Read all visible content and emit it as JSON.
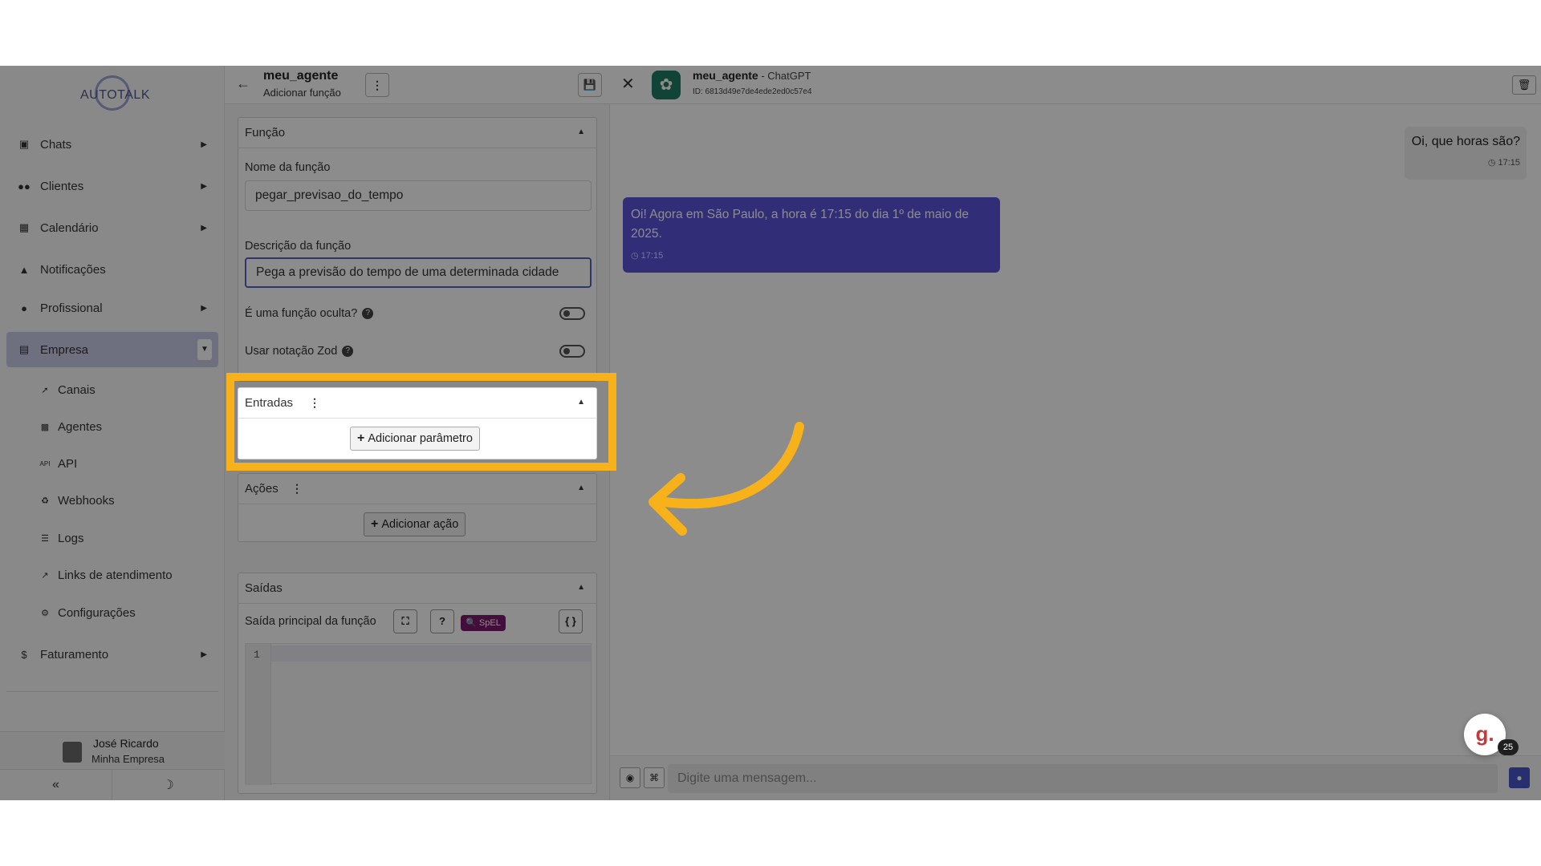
{
  "sidebar": {
    "logo": "AUTOTALK",
    "items": [
      {
        "label": "Chats",
        "icon": "chat-icon"
      },
      {
        "label": "Clientes",
        "icon": "users-icon"
      },
      {
        "label": "Calendário",
        "icon": "calendar-icon"
      },
      {
        "label": "Notificações",
        "icon": "bell-icon"
      },
      {
        "label": "Profissional",
        "icon": "user-tie-icon"
      },
      {
        "label": "Empresa",
        "icon": "building-icon"
      },
      {
        "label": "Faturamento",
        "icon": "dollar-icon"
      }
    ],
    "subitems": [
      {
        "label": "Canais",
        "icon": "rocket-icon"
      },
      {
        "label": "Agentes",
        "icon": "robot-icon"
      },
      {
        "label": "API",
        "icon": "api-icon"
      },
      {
        "label": "Webhooks",
        "icon": "webhook-icon"
      },
      {
        "label": "Logs",
        "icon": "list-icon"
      },
      {
        "label": "Links de atendimento",
        "icon": "external-link-icon"
      },
      {
        "label": "Configurações",
        "icon": "gear-icon"
      }
    ],
    "user": {
      "name": "José Ricardo",
      "company": "Minha Empresa"
    }
  },
  "editor": {
    "title": "meu_agente",
    "subtitle": "Adicionar função",
    "funcao": {
      "title": "Função",
      "name_label": "Nome da função",
      "name_value": "pegar_previsao_do_tempo",
      "desc_label": "Descrição da função",
      "desc_value": "Pega a previsão do tempo de uma determinada cidade",
      "hidden_label": "É uma função oculta?",
      "zod_label": "Usar notação Zod"
    },
    "entradas": {
      "title": "Entradas",
      "add_label": "Adicionar parâmetro"
    },
    "acoes": {
      "title": "Ações",
      "add_label": "Adicionar ação"
    },
    "saidas": {
      "title": "Saídas",
      "main_label": "Saída principal da função",
      "spel": "SpEL",
      "line_number": "1"
    }
  },
  "chat": {
    "agent_name": "meu_agente",
    "agent_model": " - ChatGPT",
    "agent_id": "ID: 6813d49e7de4ede2ed0c57e4",
    "messages": [
      {
        "text": "Oi, que horas são?",
        "time": "17:15",
        "direction": "out"
      },
      {
        "text": "Oi! Agora em São Paulo, a hora é 17:15 do dia 1º de maio de 2025.",
        "time": "17:15",
        "direction": "in"
      }
    ],
    "input_placeholder": "Digite uma mensagem...",
    "badge_count": "25",
    "widget_letter": "g."
  },
  "colors": {
    "highlight": "#f7b21b",
    "incoming_bubble": "#5a55d9",
    "accent": "#4a56c8",
    "spel_badge": "#7a1a6e"
  }
}
